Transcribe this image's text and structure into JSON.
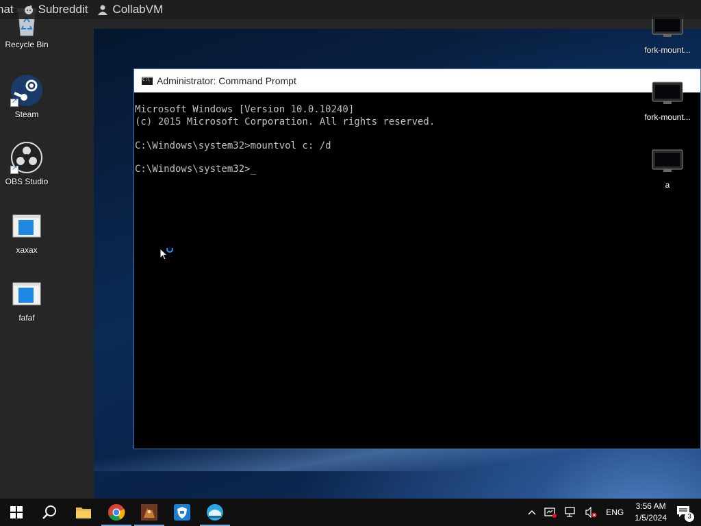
{
  "topbar": {
    "items": [
      {
        "label": "hat",
        "icon": "chat-icon"
      },
      {
        "label": "Subreddit",
        "icon": "reddit-icon"
      },
      {
        "label": "CollabVM",
        "icon": "user-icon"
      }
    ]
  },
  "desktop_left": [
    {
      "label": "Recycle Bin",
      "icon": "recycle-bin-icon"
    },
    {
      "label": "Steam",
      "icon": "steam-icon"
    },
    {
      "label": "OBS Studio",
      "icon": "obs-icon"
    },
    {
      "label": "xaxax",
      "icon": "window-file-icon"
    },
    {
      "label": "fafaf",
      "icon": "window-file-icon"
    }
  ],
  "desktop_right": [
    {
      "label": "fork-mount...",
      "icon": "monitor-icon"
    },
    {
      "label": "fork-mount...",
      "icon": "monitor-icon"
    },
    {
      "label": "a",
      "icon": "monitor-icon"
    }
  ],
  "cmd": {
    "title": "Administrator: Command Prompt",
    "lines": [
      "Microsoft Windows [Version 10.0.10240]",
      "(c) 2015 Microsoft Corporation. All rights reserved.",
      "",
      "C:\\Windows\\system32>mountvol c: /d",
      "",
      "C:\\Windows\\system32>"
    ]
  },
  "taskbar": {
    "apps": [
      "start-icon",
      "search-icon",
      "file-explorer-icon",
      "chrome-icon",
      "app-icon",
      "shield-app-icon",
      "globe-app-icon"
    ],
    "tray": {
      "language": "ENG",
      "time": "3:56 AM",
      "date": "1/5/2024",
      "notification_count": "3"
    }
  },
  "colors": {
    "accent": "#4a7bbf",
    "taskbar": "#101010",
    "console_text": "#c0c0c0"
  }
}
